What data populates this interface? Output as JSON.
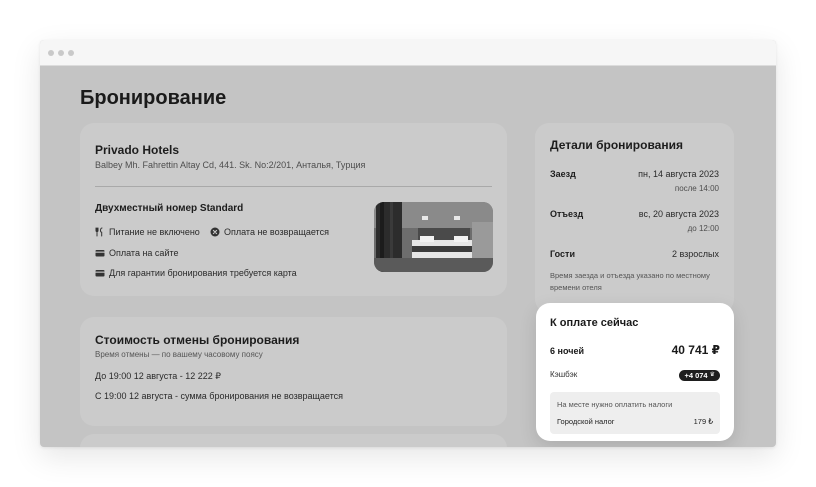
{
  "page": {
    "title": "Бронирование"
  },
  "hotel": {
    "name": "Privado Hotels",
    "address": "Balbey Mh. Fahrettin Altay Cd, 441. Sk. No:2/201, Анталья, Турция",
    "room": "Двухместный номер Standard",
    "amenities": [
      {
        "icon": "utensils-icon",
        "label": "Питание не включено"
      },
      {
        "icon": "x-circle-icon",
        "label": "Оплата не возвращается"
      },
      {
        "icon": "card-icon",
        "label": "Оплата на сайте"
      },
      {
        "icon": "card-icon",
        "label": "Для гарантии бронирования требуется карта"
      }
    ]
  },
  "cancellation": {
    "title": "Стоимость отмены бронирования",
    "subtitle": "Время отмены — по вашему часовому поясу",
    "lines": [
      "До 19:00 12 августа - 12 222 ₽",
      "С 19:00 12 августа - сумма бронирования не возвращается"
    ]
  },
  "details": {
    "title": "Детали бронирования",
    "checkin_label": "Заезд",
    "checkin_date": "пн, 14 августа 2023",
    "checkin_time": "после 14:00",
    "checkout_label": "Отъезд",
    "checkout_date": "вс, 20 августа 2023",
    "checkout_time": "до 12:00",
    "guests_label": "Гости",
    "guests_value": "2 взрослых",
    "note": "Время заезда и отъезда указано по местному времени отеля"
  },
  "payment": {
    "title": "К оплате сейчас",
    "nights_label": "6 ночей",
    "amount": "40 741 ₽",
    "cashback_label": "Кэшбэк",
    "cashback_value": "+4 074",
    "tax_note": "На месте нужно оплатить налоги",
    "tax_label": "Городской налог",
    "tax_value": "179 ₺"
  },
  "colors": {
    "overlay": "#c4c4c4",
    "card": "#cbcbcb",
    "highlight": "#ffffff",
    "badge": "#1e1e1e"
  }
}
